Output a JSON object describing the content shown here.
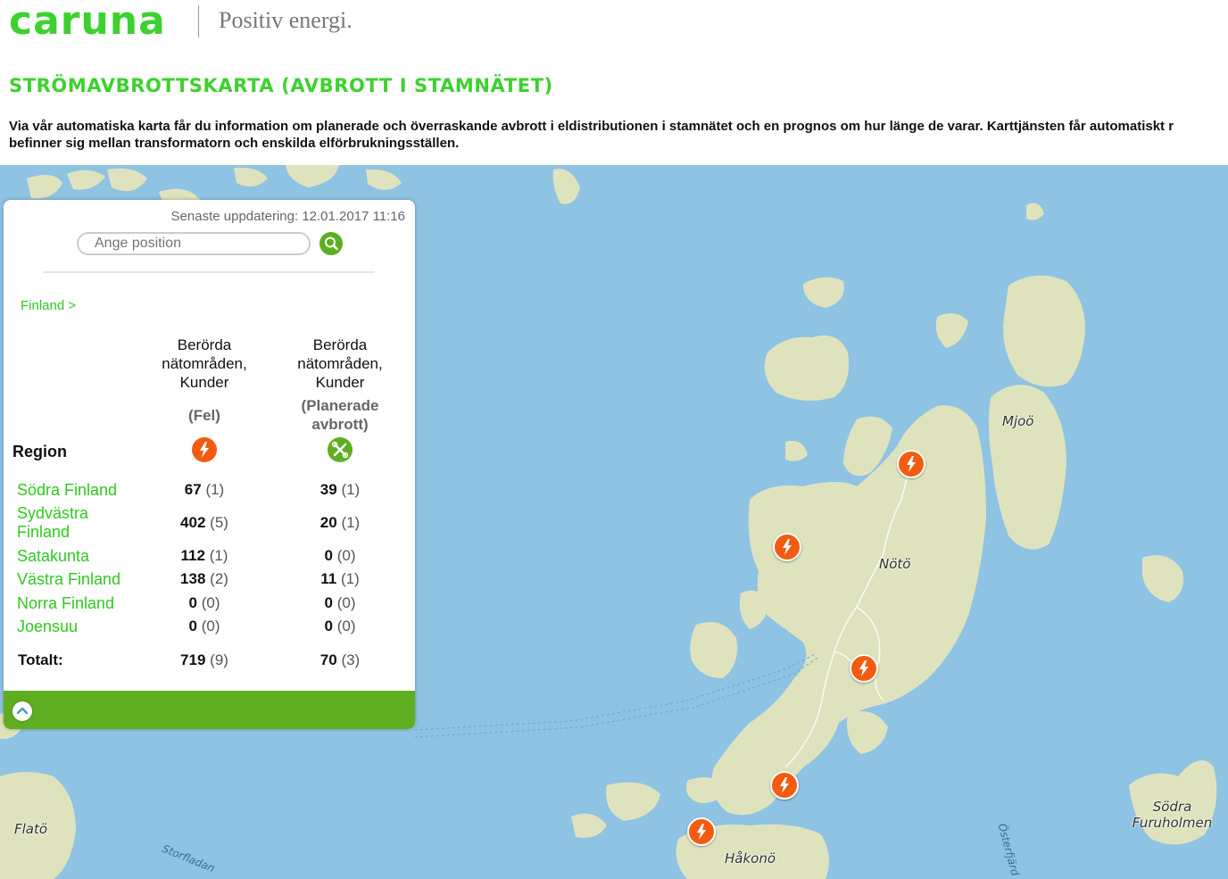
{
  "header": {
    "logo_text": "caruna",
    "slogan": "Positiv energi.",
    "title": "STRÖMAVBROTTSKARTA (AVBROTT I STAMNÄTET)",
    "intro_line1": "Via vår automatiska karta får du information om planerade och överraskande avbrott i eldistributionen i stamnätet och en prognos om hur länge de varar. Karttjänsten får automatiskt r",
    "intro_line2": "befinner sig mellan transformatorn och enskilda elförbrukningsställen."
  },
  "panel": {
    "last_updated": "Senaste uppdatering: 12.01.2017 11:16",
    "search_placeholder": "Ange position",
    "breadcrumb": "Finland >",
    "col_fault_header": [
      "Berörda",
      "nätområden,",
      "Kunder"
    ],
    "col_fault_sub": "(Fel)",
    "col_planned_header": [
      "Berörda",
      "nätområden,",
      "Kunder"
    ],
    "col_planned_sub": [
      "(Planerade",
      "avbrott)"
    ],
    "region_header": "Region",
    "icons": {
      "fault": "lightning-icon",
      "planned": "tools-icon",
      "search": "search-icon",
      "collapse": "chevron-up-icon"
    },
    "rows": [
      {
        "name": "Södra Finland",
        "fault_customers": "67",
        "fault_areas": "(1)",
        "planned_customers": "39",
        "planned_areas": "(1)"
      },
      {
        "name": "Sydvästra Finland",
        "fault_customers": "402",
        "fault_areas": "(5)",
        "planned_customers": "20",
        "planned_areas": "(1)"
      },
      {
        "name": "Satakunta",
        "fault_customers": "112",
        "fault_areas": "(1)",
        "planned_customers": "0",
        "planned_areas": "(0)"
      },
      {
        "name": "Västra Finland",
        "fault_customers": "138",
        "fault_areas": "(2)",
        "planned_customers": "11",
        "planned_areas": "(1)"
      },
      {
        "name": "Norra Finland",
        "fault_customers": "0",
        "fault_areas": "(0)",
        "planned_customers": "0",
        "planned_areas": "(0)"
      },
      {
        "name": "Joensuu",
        "fault_customers": "0",
        "fault_areas": "(0)",
        "planned_customers": "0",
        "planned_areas": "(0)"
      }
    ],
    "total": {
      "label": "Totalt:",
      "fault_customers": "719",
      "fault_areas": "(9)",
      "planned_customers": "70",
      "planned_areas": "(3)"
    }
  },
  "map": {
    "places": [
      "Mjoö",
      "Nötö",
      "Flatö",
      "Håkonö",
      "Södra Furuholmen"
    ],
    "water_labels": [
      "Storfladan",
      "Österfjärd"
    ],
    "colors": {
      "water": "#8fc3e3",
      "land": "#dfe3bd",
      "fault": "#f25c12",
      "planned": "#5fae21",
      "brand": "#3dd12f"
    }
  }
}
